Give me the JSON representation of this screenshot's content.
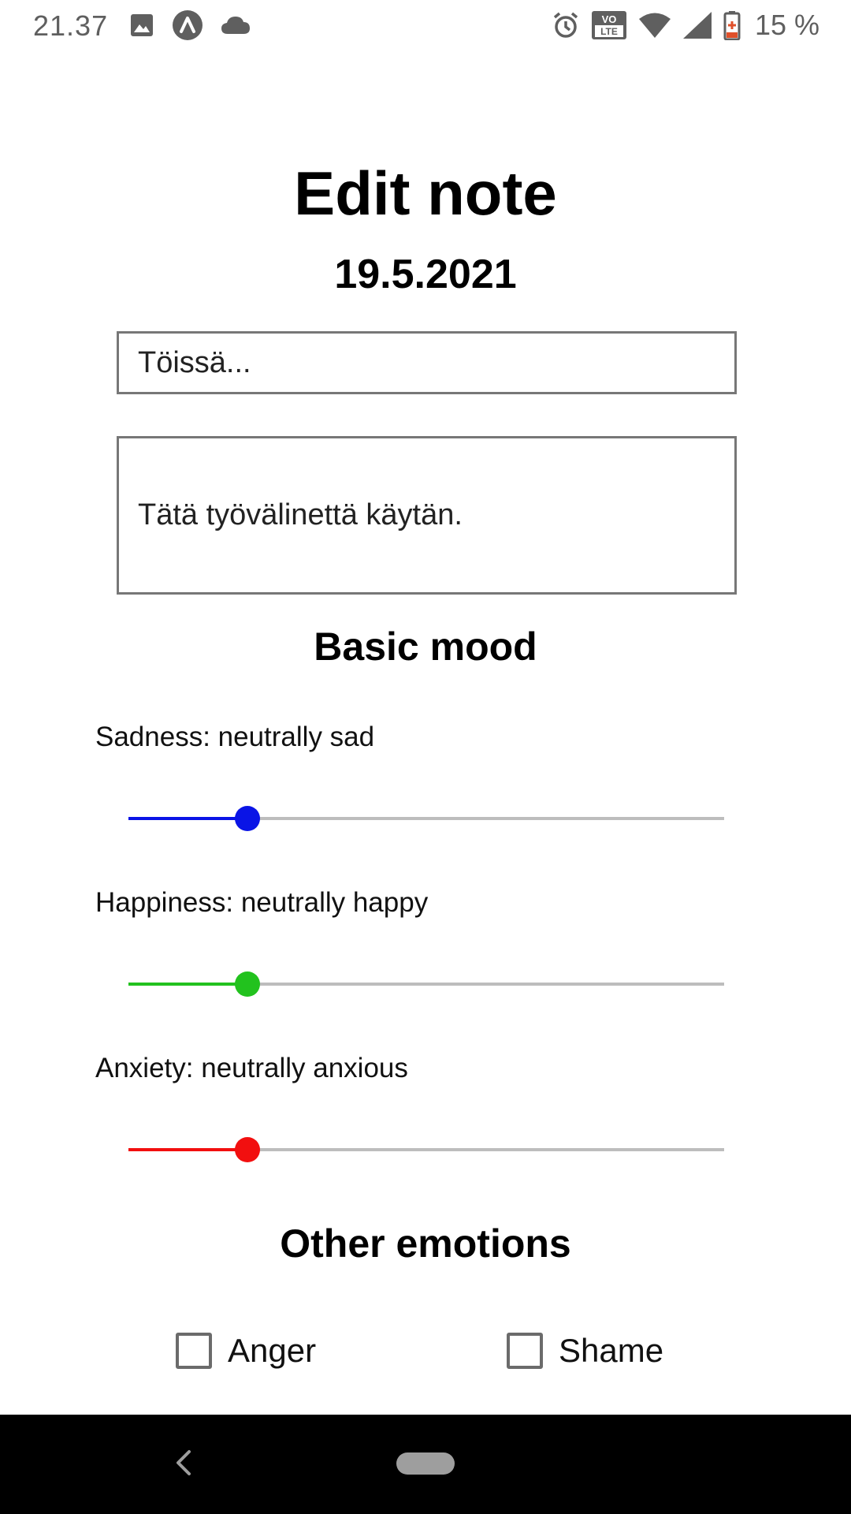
{
  "status_bar": {
    "time": "21.37",
    "battery_percent": "15 %",
    "network_badge_line1": "VO",
    "network_badge_line2": "LTE",
    "left_icons": [
      "image-icon",
      "app-icon",
      "cloud-icon"
    ],
    "right_icons": [
      "alarm-icon",
      "volte-icon",
      "wifi-icon",
      "signal-icon",
      "battery-icon"
    ]
  },
  "page": {
    "title": "Edit note",
    "date": "19.5.2021"
  },
  "note": {
    "title_value": "Töissä...",
    "body_text": "Tätä työvälinettä käytän."
  },
  "basic_mood": {
    "heading": "Basic mood",
    "sliders": [
      {
        "label": "Sadness: neutrally sad",
        "level": 0.2,
        "color": "#0a14e6"
      },
      {
        "label": "Happiness: neutrally happy",
        "level": 0.2,
        "color": "#22c21e"
      },
      {
        "label": "Anxiety: neutrally anxious",
        "level": 0.2,
        "color": "#f20f0f"
      }
    ]
  },
  "other_emotions": {
    "heading": "Other emotions",
    "options": [
      {
        "label": "Anger",
        "checked": false
      },
      {
        "label": "Shame",
        "checked": false
      }
    ]
  },
  "colors": {
    "track": "#bdbdbd",
    "input_border": "#777777",
    "nav_bar": "#000000"
  }
}
